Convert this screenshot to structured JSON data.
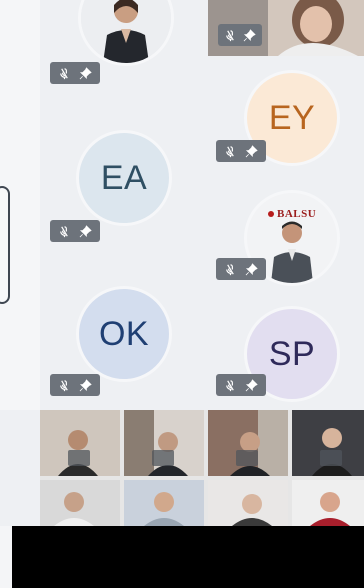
{
  "participants": {
    "tiles": [
      {
        "kind": "photo",
        "name": "participant-photo-top-left"
      },
      {
        "kind": "photo",
        "name": "participant-photo-top-right"
      },
      {
        "kind": "initials",
        "initials": "EY",
        "bg": "#fbe9d6",
        "fg": "#b8651f"
      },
      {
        "kind": "initials",
        "initials": "EA",
        "bg": "#dce6ee",
        "fg": "#2f4f63"
      },
      {
        "kind": "photo-logo",
        "logo_text": "BALSU"
      },
      {
        "kind": "initials",
        "initials": "OK",
        "bg": "#d3ddee",
        "fg": "#1f3f73"
      },
      {
        "kind": "initials",
        "initials": "SP",
        "bg": "#e2def0",
        "fg": "#2f2a5a"
      }
    ],
    "icons": {
      "mute": "mic-off-icon",
      "pin": "pin-icon"
    }
  },
  "colors": {
    "page_bg": "#eef0f3",
    "control_bg": "#6d737b",
    "bottom_bar": "#000000"
  }
}
